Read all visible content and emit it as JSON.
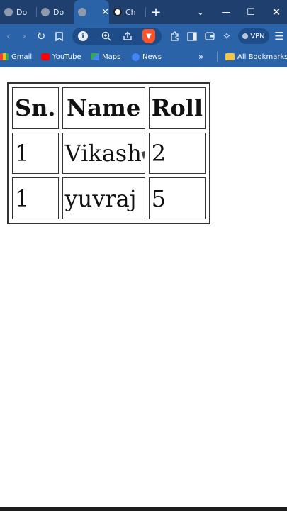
{
  "browser": {
    "tabs": [
      {
        "title": "Do",
        "icon": "globe-icon",
        "active": false
      },
      {
        "title": "Do",
        "icon": "globe-icon",
        "active": false
      },
      {
        "title": "",
        "icon": "globe-icon",
        "active": true
      },
      {
        "title": "Ch",
        "icon": "chatgpt-icon",
        "active": false
      }
    ],
    "new_tab_glyph": "+",
    "vpn_label": "VPN",
    "bookmarks": [
      "Gmail",
      "YouTube",
      "Maps",
      "News"
    ],
    "bookmarks_more_glyph": "»",
    "all_bookmarks_label": "All Bookmarks",
    "colors": {
      "tabstrip": "#1f3f6e",
      "toolbar": "#2a63a8",
      "brave_orange": "#fb542b"
    }
  },
  "table": {
    "headers": [
      "Sn.",
      "Name",
      "Roll"
    ],
    "rows": [
      [
        "1",
        "Vikash",
        "2"
      ],
      [
        "1",
        "yuvraj",
        "5"
      ]
    ]
  }
}
